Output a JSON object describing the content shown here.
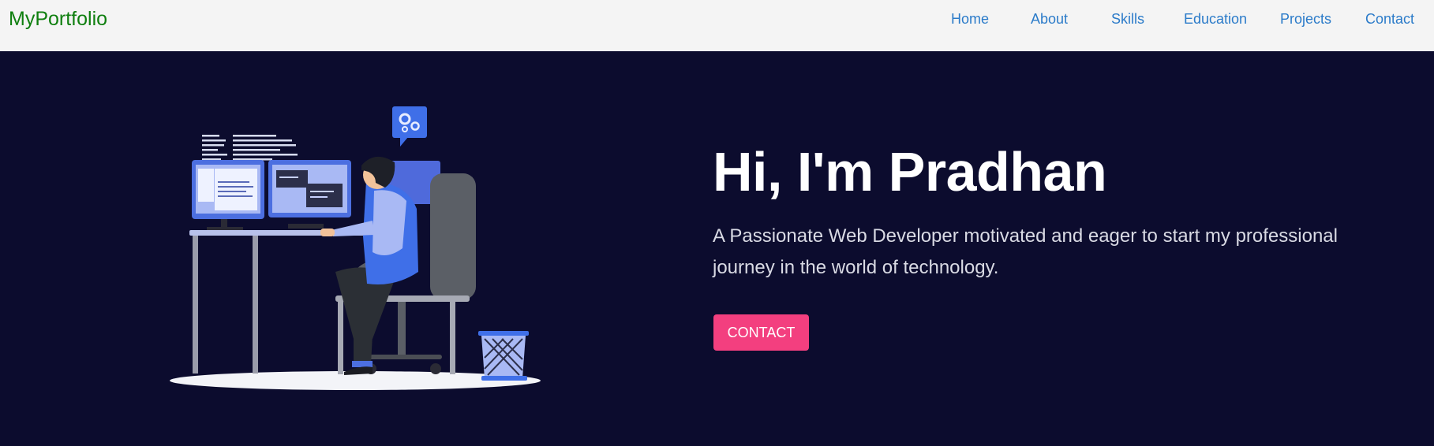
{
  "navbar": {
    "brand": "MyPortfolio",
    "links": [
      {
        "label": "Home"
      },
      {
        "label": "About"
      },
      {
        "label": "Skills"
      },
      {
        "label": "Education"
      },
      {
        "label": "Projects"
      },
      {
        "label": "Contact"
      }
    ]
  },
  "hero": {
    "title": "Hi, I'm Pradhan",
    "subtitle": "A Passionate Web Developer motivated and eager to start my professional journey in the world of technology.",
    "cta_label": "CONTACT",
    "illustration_icon": "developer-at-desk-illustration"
  },
  "colors": {
    "navbar_bg": "#f4f4f4",
    "brand": "#0f7f0f",
    "nav_link": "#2b7bc9",
    "hero_bg": "#0c0c2e",
    "cta": "#f33f7f",
    "accent_blue": "#3f6fe8"
  }
}
